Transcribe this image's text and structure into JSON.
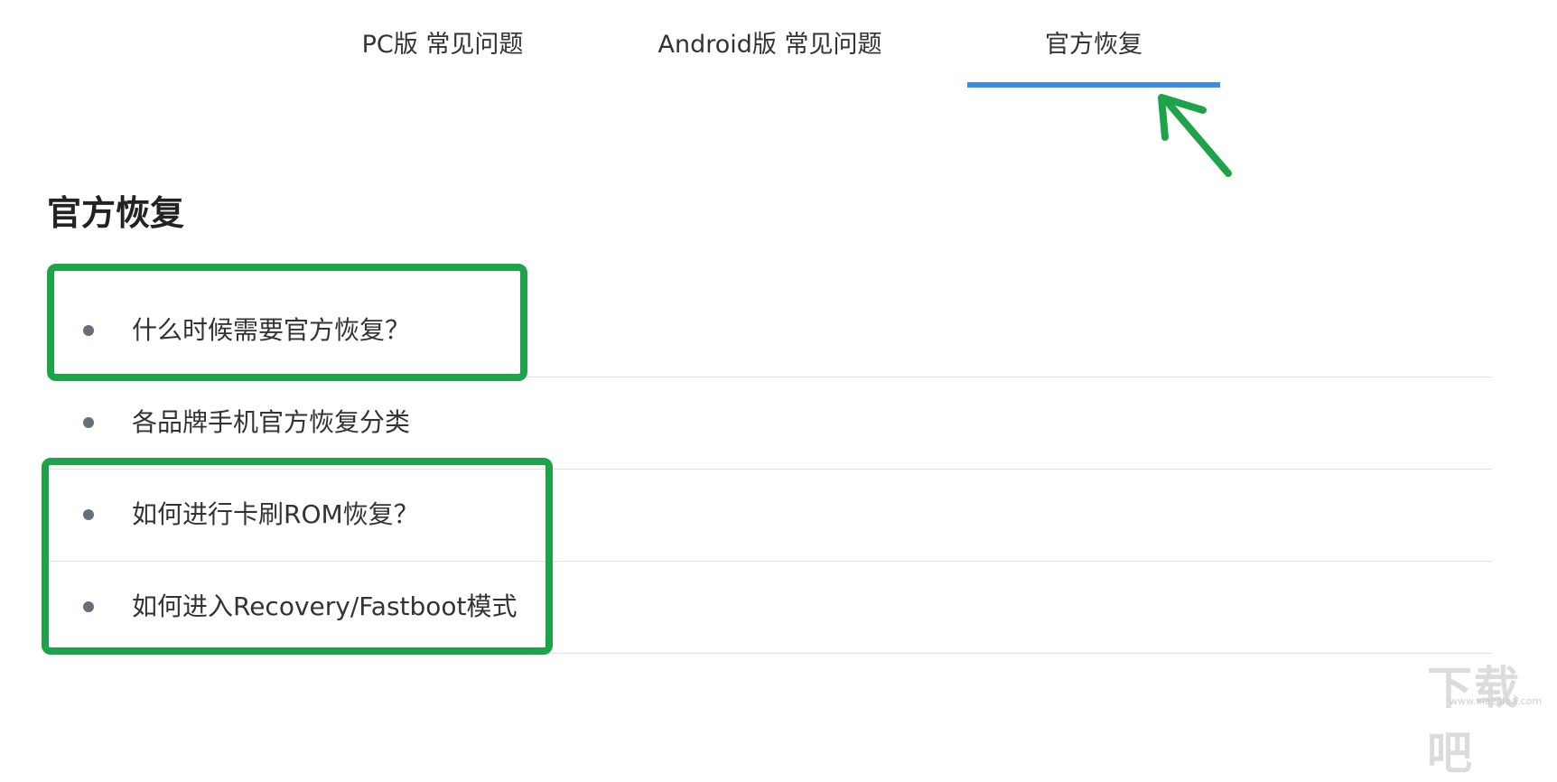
{
  "tabs": [
    {
      "label": "PC版 常见问题",
      "active": false
    },
    {
      "label": "Android版 常见问题",
      "active": false
    },
    {
      "label": "官方恢复",
      "active": true
    }
  ],
  "page_title": "官方恢复",
  "faq_items": [
    {
      "label": "什么时候需要官方恢复？"
    },
    {
      "label": "各品牌手机官方恢复分类"
    },
    {
      "label": "如何进行卡刷ROM恢复？"
    },
    {
      "label": "如何进入Recovery/Fastboot模式"
    }
  ],
  "annotations": {
    "highlight_color": "#1fa34a",
    "active_tab_color": "#3a8ee6",
    "arrow_icon": "green-arrow-icon"
  },
  "watermark": {
    "text": "下载吧",
    "url": "www.xiazaiba.com"
  }
}
